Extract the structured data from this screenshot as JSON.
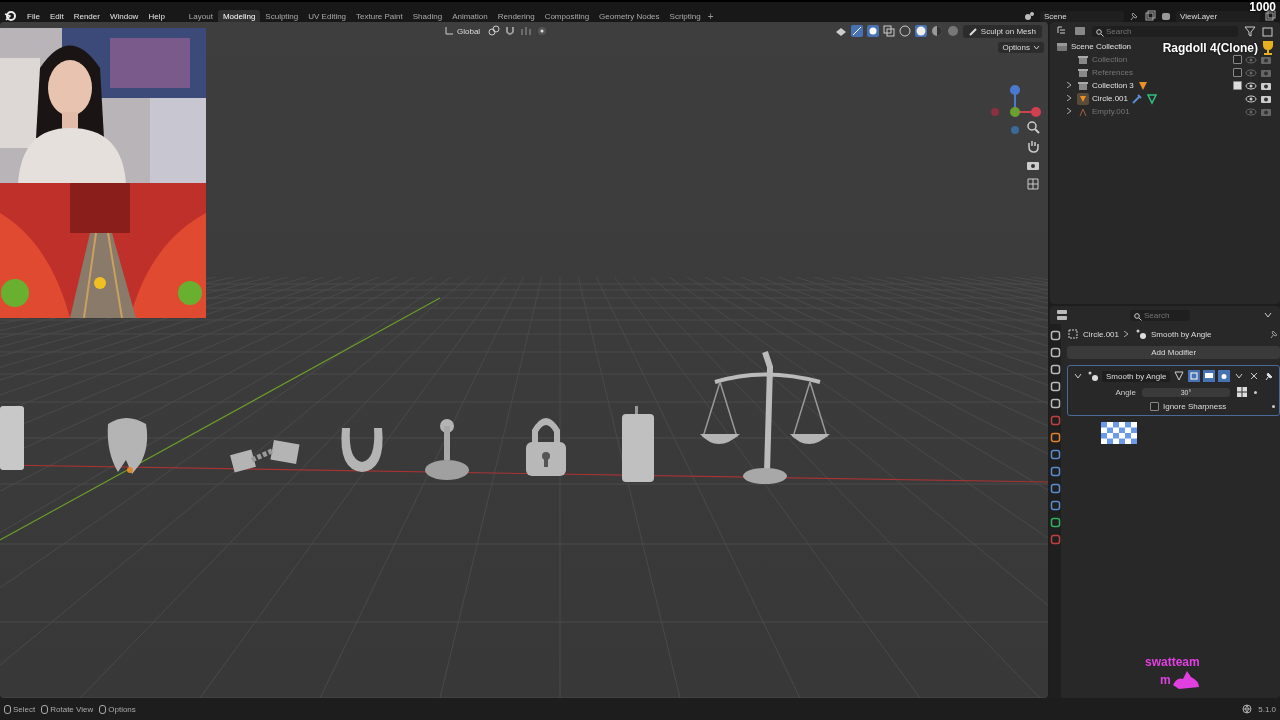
{
  "menus": [
    "File",
    "Edit",
    "Render",
    "Window",
    "Help"
  ],
  "workspaces": [
    {
      "label": "Layout",
      "selected": false
    },
    {
      "label": "Modeling",
      "selected": true
    },
    {
      "label": "Sculpting",
      "selected": false
    },
    {
      "label": "UV Editing",
      "selected": false
    },
    {
      "label": "Texture Paint",
      "selected": false
    },
    {
      "label": "Shading",
      "selected": false
    },
    {
      "label": "Animation",
      "selected": false
    },
    {
      "label": "Rendering",
      "selected": false
    },
    {
      "label": "Compositing",
      "selected": false
    },
    {
      "label": "Geometry Nodes",
      "selected": false
    },
    {
      "label": "Scripting",
      "selected": false
    }
  ],
  "add_workspace": "+",
  "scene": "Scene",
  "view_layer": "ViewLayer",
  "viewport": {
    "orientation": "Global",
    "mode_button": "Sculpt on Mesh",
    "options": "Options"
  },
  "outliner": {
    "search_placeholder": "Search",
    "items": [
      {
        "label": "Scene Collection",
        "kind": "scene",
        "children": [
          {
            "label": "Collection",
            "kind": "collection",
            "dimmed": true,
            "checked": false
          },
          {
            "label": "References",
            "kind": "collection",
            "dimmed": true,
            "checked": false
          },
          {
            "label": "Collection 3",
            "kind": "collection",
            "dimmed": false,
            "checked": true,
            "expanded": false
          },
          {
            "label": "Circle.001",
            "kind": "mesh",
            "dimmed": false,
            "expanded": false
          },
          {
            "label": "Empty.001",
            "kind": "empty",
            "dimmed": true,
            "expanded": false
          }
        ]
      }
    ]
  },
  "properties": {
    "search_placeholder": "Search",
    "breadcrumb": [
      "Circle.001",
      "Smooth by Angle"
    ],
    "add_modifier": "Add Modifier",
    "modifier": {
      "name": "Smooth by Angle",
      "angle_label": "Angle",
      "angle_value": "30°",
      "option": {
        "label": "Ignore Sharpness",
        "checked": false
      }
    }
  },
  "status_bar": {
    "hints": [
      "Select",
      "Rotate View",
      "Options"
    ],
    "version": "5.1.0"
  },
  "overlays": {
    "counter": "1000",
    "title": "Ragdoll 4(Clone)",
    "brand": "swatteam",
    "brand_sub": "m"
  }
}
